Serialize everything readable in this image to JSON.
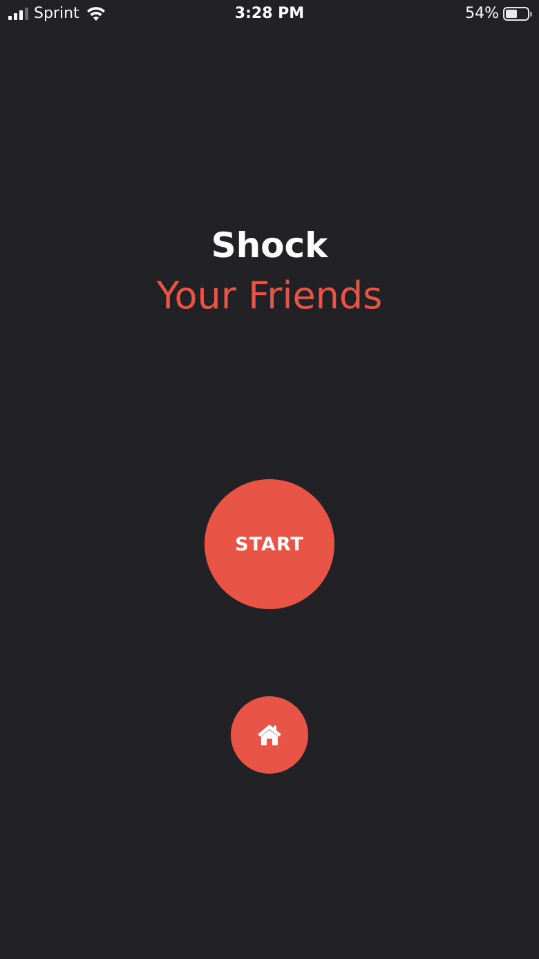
{
  "status_bar": {
    "carrier": "Sprint",
    "time": "3:28 PM",
    "battery_percent": "54%",
    "battery_level": 0.54,
    "signal_bars": 3,
    "signal_bars_total": 4
  },
  "headline": {
    "line1": "Shock",
    "line2": "Your Friends"
  },
  "buttons": {
    "start_label": "START",
    "home_icon": "home-icon"
  },
  "colors": {
    "background": "#222226",
    "accent": "#e85445",
    "text": "#ffffff"
  }
}
